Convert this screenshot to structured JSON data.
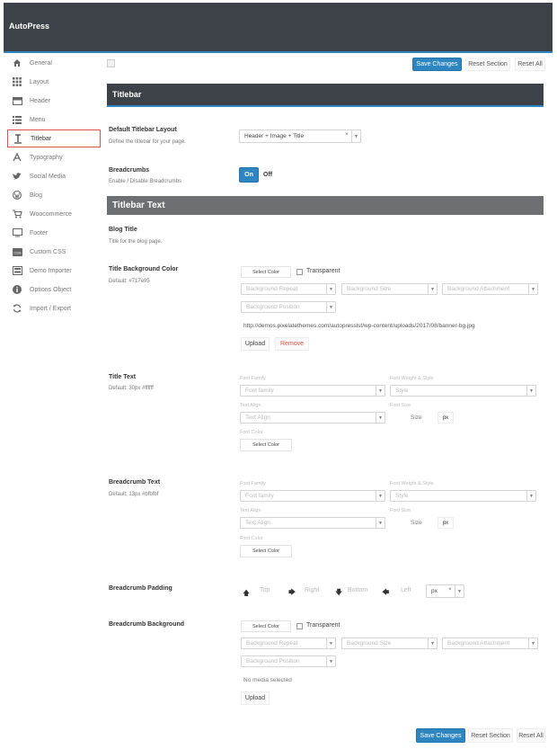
{
  "app": {
    "title": "AutoPress"
  },
  "sidebar": {
    "items": [
      {
        "label": "General",
        "icon": "home-icon"
      },
      {
        "label": "Layout",
        "icon": "grid-icon"
      },
      {
        "label": "Header",
        "icon": "header-icon"
      },
      {
        "label": "Menu",
        "icon": "list-icon"
      },
      {
        "label": "Titlebar",
        "icon": "text-cursor-icon",
        "active": true
      },
      {
        "label": "Typography",
        "icon": "font-icon"
      },
      {
        "label": "Social Media",
        "icon": "twitter-icon"
      },
      {
        "label": "Blog",
        "icon": "wordpress-icon"
      },
      {
        "label": "Woocommerce",
        "icon": "cart-icon"
      },
      {
        "label": "Footer",
        "icon": "monitor-icon"
      },
      {
        "label": "Custom CSS",
        "icon": "css-icon"
      },
      {
        "label": "Demo Importer",
        "icon": "import-icon"
      },
      {
        "label": "Options Object",
        "icon": "info-icon"
      },
      {
        "label": "Import / Export",
        "icon": "refresh-icon"
      }
    ]
  },
  "toolbar": {
    "save": "Save Changes",
    "reset_section": "Reset Section",
    "reset_all": "Reset All"
  },
  "titlebar": {
    "heading": "Titlebar",
    "layout": {
      "label": "Default Titlebar Layout",
      "desc": "Define the titlebar for your page.",
      "value": "Header + Image + Title",
      "clear": "×"
    },
    "breadcrumbs": {
      "label": "Breadcrumbs",
      "desc": "Enable / Disable Breadcrumbs",
      "on": "On",
      "off": "Off"
    }
  },
  "titlebar_text": {
    "heading": "Titlebar Text",
    "blog_title": {
      "label": "Blog Title",
      "desc": "Title for the blog page."
    },
    "bg_color": {
      "label": "Title Background Color",
      "desc": "Default: #717e95",
      "select_color": "Select Color",
      "transparent": "Transparent",
      "repeat": "Background Repeat",
      "size": "Background Size",
      "attachment": "Background Attachment",
      "position": "Background Position",
      "url": "http://demos.pixelatethemes.com/autopresslst/wp-content/uploads/2017/08/banner-bg.jpg",
      "upload": "Upload",
      "remove": "Remove"
    },
    "title_text": {
      "label": "Title Text",
      "desc": "Default: 30px #ffffff",
      "font_family_lbl": "Font Family",
      "font_family_ph": "Font family",
      "weight_lbl": "Font Weight & Style",
      "weight_ph": "Style",
      "align_lbl": "Text Align",
      "align_ph": "Text Align",
      "size_lbl": "Font Size",
      "size_ph": "Size",
      "unit": "px",
      "color_lbl": "Font Color",
      "select_color": "Select Color"
    },
    "breadcrumb_text": {
      "label": "Breadcrumb Text",
      "desc": "Default: 13px #bfbfbf",
      "font_family_lbl": "Font Family",
      "font_family_ph": "Font family",
      "weight_lbl": "Font Weight & Style",
      "weight_ph": "Style",
      "align_lbl": "Text Align",
      "align_ph": "Text Align",
      "size_lbl": "Font Size",
      "size_ph": "Size",
      "unit": "px",
      "color_lbl": "Font Color",
      "select_color": "Select Color"
    },
    "breadcrumb_padding": {
      "label": "Breadcrumb Padding",
      "top": "Top",
      "right": "Right",
      "bottom": "Bottom",
      "left": "Left",
      "unit": "px",
      "clear": "×"
    },
    "breadcrumb_bg": {
      "label": "Breadcrumb Background",
      "select_color": "Select Color",
      "transparent": "Transparent",
      "repeat": "Background Repeat",
      "size": "Background Size",
      "attachment": "Background Attachment",
      "position": "Background Position",
      "no_media": "No media selected",
      "upload": "Upload"
    }
  },
  "colors": {
    "accent": "#2e86c1",
    "topbar": "#3c4247",
    "section2": "#6d6f72",
    "remove": "#e74c3c",
    "active_border": "#d9534f"
  }
}
